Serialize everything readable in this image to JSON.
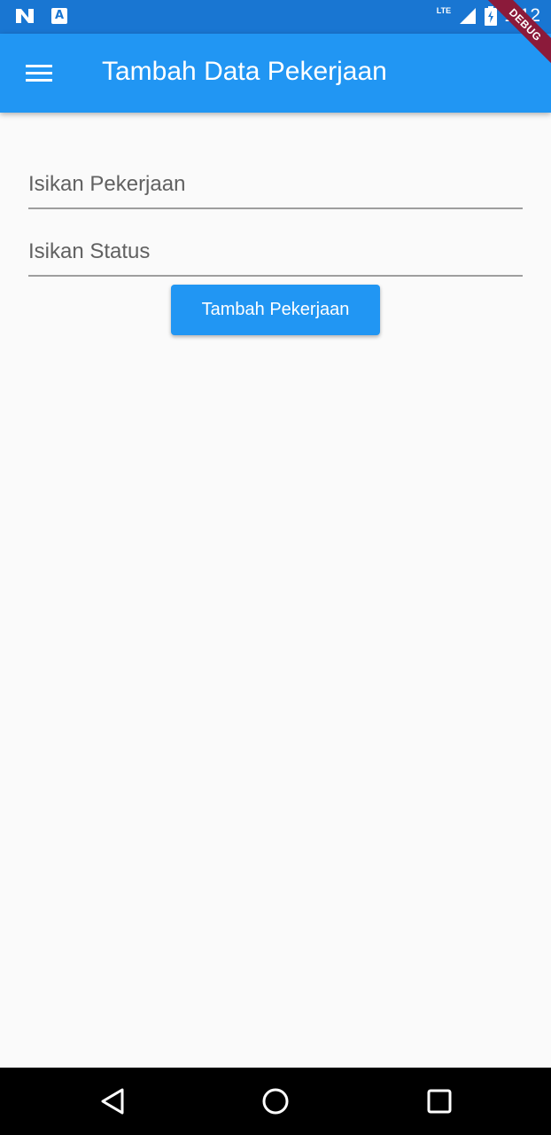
{
  "status_bar": {
    "network": "LTE",
    "time": "1:12",
    "notif_letter": "A"
  },
  "debug_banner": "DEBUG",
  "app_bar": {
    "title": "Tambah Data Pekerjaan",
    "menu_icon": "hamburger-menu-icon"
  },
  "form": {
    "pekerjaan": {
      "placeholder": "Isikan Pekerjaan",
      "value": ""
    },
    "status": {
      "placeholder": "Isikan Status",
      "value": ""
    },
    "submit_label": "Tambah Pekerjaan"
  },
  "colors": {
    "primary": "#2196f3",
    "status_bar": "#1976d2",
    "background": "#fafafa"
  },
  "nav_bar": {
    "back_icon": "back-triangle-icon",
    "home_icon": "home-circle-icon",
    "recent_icon": "recent-apps-square-icon"
  }
}
